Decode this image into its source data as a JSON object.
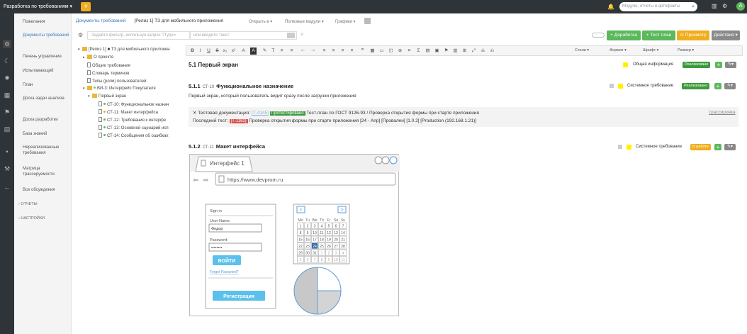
{
  "topbar": {
    "brand": "Разработка по требованиям ▾",
    "add_icon": "+",
    "search_placeholder": "Модули, отчеты и артефакты",
    "colors": {
      "bar": "#2f3439",
      "add": "#f0ad1e",
      "avatar": "#5cb85c"
    },
    "avatar_letter": "А"
  },
  "sidebar": {
    "items": [
      "Пожелания",
      "Документы требований",
      "Печень управления",
      "Испытавающий",
      "План",
      "Доска задач анализа",
      "Доска разработки",
      "База знаний",
      "Нереализованные требования",
      "Матрица трассируемости",
      "Все обсуждения"
    ],
    "sections": [
      "ОТЧЕТЫ",
      "НАСТРОЙКИ"
    ]
  },
  "breadcrumb": {
    "root": "Документы требований",
    "current": "[Релиз 1] ТЗ для мобильного приложения"
  },
  "nav_dropdowns": [
    "Открыть в ▾",
    "Полезные модули ▾",
    "Графики ▾"
  ],
  "filter": {
    "placeholder": "Задайте фильтр, используя запрос ?Type=",
    "search_placeholder": "или введите текст"
  },
  "actions": {
    "refine": "+ Доработка",
    "testplan": "+ Тест план",
    "review": "⊙ Просмотр",
    "actions": "Действия ▾"
  },
  "tree": [
    {
      "text": "[Релиз 1] ■ ТЗ для мобильного приложен",
      "kind": "folder",
      "tri": "▾"
    },
    {
      "text": "О проекте",
      "kind": "folder",
      "tri": "▸"
    },
    {
      "text": "Общие требования",
      "kind": "doc"
    },
    {
      "text": "Словарь терминов",
      "kind": "doc"
    },
    {
      "text": "Типы (роли) пользователей",
      "kind": "doc"
    },
    {
      "text": "ВИ-3: Интерфейс Покупателя",
      "kind": "folder",
      "tri": "▾",
      "dot": "#8bc34a"
    },
    {
      "text": "Первый экран",
      "kind": "folder",
      "tri": "▾"
    },
    {
      "text": "СТ-10: Функциональное назнач",
      "kind": "doc",
      "dot": "#5cb85c"
    },
    {
      "text": "СТ-11: Макет интерфейса",
      "kind": "doc",
      "dot": "#f0ad1e"
    },
    {
      "text": "СТ-12: Требования к интерфе",
      "kind": "doc",
      "dot": "#5cb85c"
    },
    {
      "text": "СТ-13: Основной сценарий исп",
      "kind": "doc",
      "dot": "#5cb85c"
    },
    {
      "text": "СТ-14: Сообщения об ошибках",
      "kind": "doc",
      "dot": "#5cb85c"
    }
  ],
  "editor_toolbar": {
    "buttons": [
      "B",
      "I",
      "U",
      "S",
      "x₂",
      "x²",
      "A",
      "A",
      "✎",
      "T",
      "≡",
      "≡",
      "⇤",
      "⇥",
      "≡",
      "≡",
      "≡",
      "≡",
      "❞",
      "▦",
      "▭",
      "◫",
      "⊕",
      "⌗",
      "Σ",
      "▤",
      "▣",
      "⚑",
      "▥",
      "⊞",
      "⤢",
      "⎌",
      "⎌"
    ],
    "dropdowns": [
      "Стили",
      "Формат",
      "Шрифт",
      "Размер"
    ]
  },
  "sections": {
    "s51": {
      "title": "5.1 Первый экран",
      "tag": "Общая информация",
      "status": "Реализовано",
      "status_color": "#3c9a3c"
    },
    "s511": {
      "num": "5.1.1",
      "code": "СТ-10",
      "title": "Функциональное назначение",
      "tag": "Системное требование",
      "status": "Реализовано",
      "status_color": "#3c9a3c"
    },
    "desc": "Первый экран, который пользователь видит сразу после загрузки приложения",
    "trace": {
      "label": "Тестовая документация:",
      "ref": "[Т-4145]",
      "badge": "Протестировано",
      "line1": "Тест-план по ГОСТ 9126-93 / Проверка открытия формы при старте приложения",
      "trace_link": "трассировка",
      "last_label": "Последний тест:",
      "last_badge": "[Т-1162]",
      "line2": "Проверка открытия формы при старте приложения [24 - Anp] [Провален] [1.0.2] [Production (192.168.1.21)]",
      "colors": {
        "badge": "#5cb85c",
        "fail": "#d9534f"
      }
    },
    "s512": {
      "num": "5.1.2",
      "code": "СТ-11",
      "title": "Макет интерфейса",
      "tag": "Системное требование",
      "status": "В работе",
      "status_color": "#f0ad1e"
    }
  },
  "mockup": {
    "tab": "Интерфейс 1",
    "url": "https://www.devprom.ru",
    "signin": "Sign in",
    "user_label": "User Name:",
    "user_value": "Федор",
    "pass_label": "Password:",
    "pass_value": "••••••••",
    "login_btn": "ВОЙТИ",
    "forgot": "Forgot Password?",
    "register_btn": "Регистрация",
    "cal_prev": "<",
    "cal_next": ">",
    "weekdays": [
      "Mo",
      "Tu",
      "We",
      "Th",
      "Fr",
      "Sa",
      "Su"
    ],
    "days": [
      "1",
      "2",
      "3",
      "4",
      "5",
      "6",
      "7",
      "8",
      "9",
      "10",
      "11",
      "12",
      "13",
      "14",
      "15",
      "16",
      "17",
      "18",
      "19",
      "20",
      "21",
      "22",
      "23",
      "24",
      "25",
      "26",
      "27",
      "28",
      "29",
      "30",
      "31",
      "1",
      "2",
      "3",
      "4",
      "5",
      "6",
      "7",
      "8",
      "9",
      "10",
      "11"
    ],
    "selected_day_index": 23,
    "pie_slices": [
      0.25,
      0.25,
      0.5
    ],
    "colors": {
      "button": "#5bc0eb",
      "selected": "#2b6cb0",
      "pie_blue": "#5b9bd5",
      "pie_gray": "#c8c8c8"
    }
  }
}
